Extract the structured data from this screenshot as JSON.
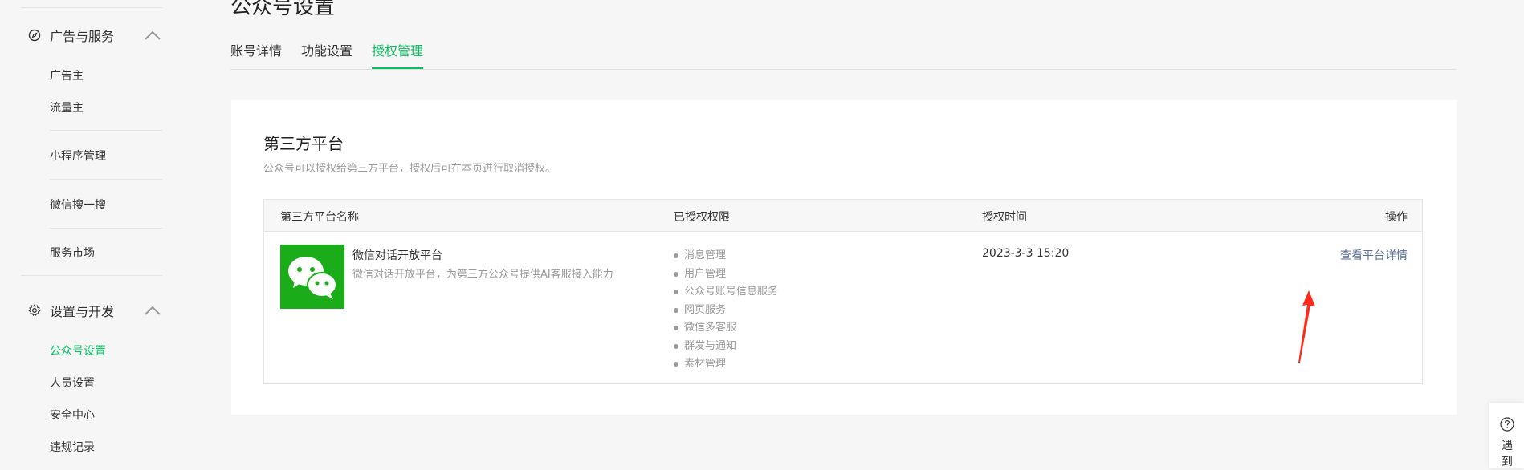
{
  "sidebar": {
    "sections": [
      {
        "label": "广告与服务",
        "icon": "compass-icon"
      },
      {
        "label": "设置与开发",
        "icon": "gear-icon"
      }
    ],
    "items": [
      {
        "label": "广告主"
      },
      {
        "label": "流量主"
      },
      {
        "label": "小程序管理"
      },
      {
        "label": "微信搜一搜"
      },
      {
        "label": "服务市场"
      },
      {
        "label": "公众号设置",
        "active": true
      },
      {
        "label": "人员设置"
      },
      {
        "label": "安全中心"
      },
      {
        "label": "违规记录"
      }
    ]
  },
  "page": {
    "title": "公众号设置",
    "tabs": [
      {
        "label": "账号详情"
      },
      {
        "label": "功能设置"
      },
      {
        "label": "授权管理",
        "active": true
      }
    ]
  },
  "card": {
    "title": "第三方平台",
    "description": "公众号可以授权给第三方平台，授权后可在本页进行取消授权。",
    "table": {
      "headers": [
        "第三方平台名称",
        "已授权权限",
        "授权时间",
        "操作"
      ],
      "rows": [
        {
          "name": "微信对话开放平台",
          "description": "微信对话开放平台，为第三方公众号提供AI客服接入能力",
          "permissions": [
            "消息管理",
            "用户管理",
            "公众号账号信息服务",
            "网页服务",
            "微信多客服",
            "群发与通知",
            "素材管理"
          ],
          "time": "2023-3-3 15:20",
          "action": "查看平台详情"
        }
      ]
    }
  },
  "help": {
    "label": "遇到"
  },
  "colors": {
    "accent": "#07c160",
    "link": "#576b95",
    "logo_bg": "#1aad19",
    "annotation_arrow": "#ff2a1a"
  },
  "icons": {
    "logo": "wechat-logo-icon",
    "help": "question-circle-icon",
    "annotation": "red-arrow-icon"
  }
}
